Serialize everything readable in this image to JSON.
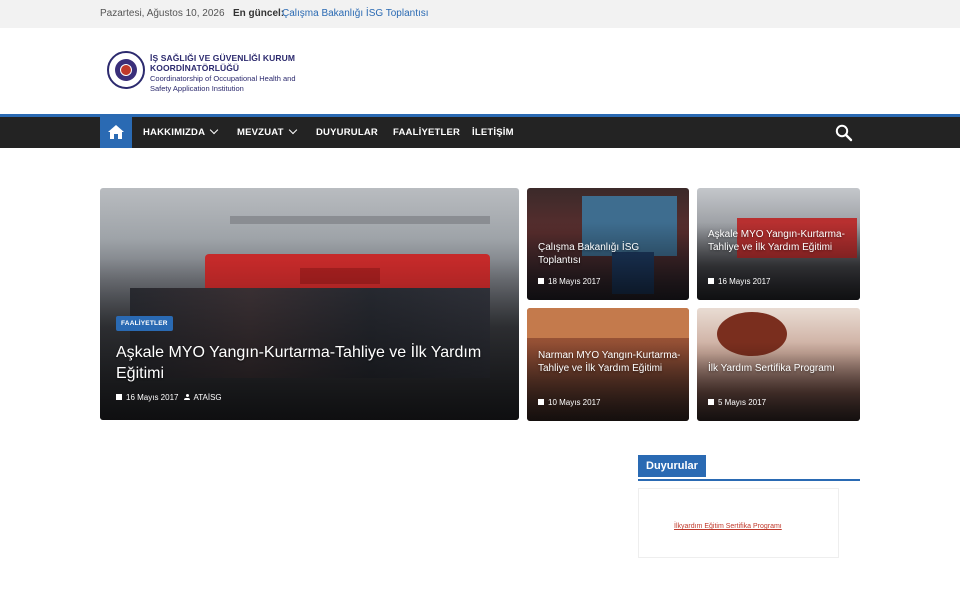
{
  "topbar": {
    "date": "Pazartesi, Ağustos 10, 2026",
    "latest_label": "En güncel:",
    "latest_link": "Çalışma Bakanlığı İSG Toplantısı"
  },
  "logo": {
    "title_line1": "İŞ SAĞLIĞI VE GÜVENLİĞİ KURUM",
    "title_line2": "KOORDİNATÖRLÜĞÜ",
    "sub_line1": "Coordinatorship of Occupational Health and",
    "sub_line2": "Safety Application Institution"
  },
  "nav": {
    "items": [
      {
        "label": "HAKKIMIZDA",
        "dropdown": true
      },
      {
        "label": "MEVZUAT",
        "dropdown": true
      },
      {
        "label": "DUYURULAR",
        "dropdown": false
      },
      {
        "label": "FAALİYETLER",
        "dropdown": false
      },
      {
        "label": "İLETİŞİM",
        "dropdown": false
      }
    ],
    "icons": {
      "home": "home-icon",
      "search": "search-icon"
    }
  },
  "featured": {
    "category": "FAALİYETLER",
    "title": "Aşkale MYO Yangın-Kurtarma-Tahliye ve İlk Yardım Eğitimi",
    "date": "16 Mayıs 2017",
    "author": "ATAİSG"
  },
  "posts": [
    {
      "title": "Çalışma Bakanlığı İSG Toplantısı",
      "date": "18 Mayıs 2017"
    },
    {
      "title": "Aşkale MYO Yangın-Kurtarma-Tahliye ve İlk Yardım Eğitimi",
      "date": "16 Mayıs 2017"
    },
    {
      "title": "Narman MYO Yangın-Kurtarma-Tahliye ve İlk Yardım Eğitimi",
      "date": "10 Mayıs 2017"
    },
    {
      "title": "İlk Yardım Sertifika Programı",
      "date": "5 Mayıs 2017"
    }
  ],
  "widget": {
    "title": "Duyurular",
    "link": "İlkyardım Eğitim Sertifika Programı"
  },
  "colors": {
    "accent": "#2a6ab3",
    "nav_bg": "#232323",
    "logo": "#2c2a6e"
  }
}
